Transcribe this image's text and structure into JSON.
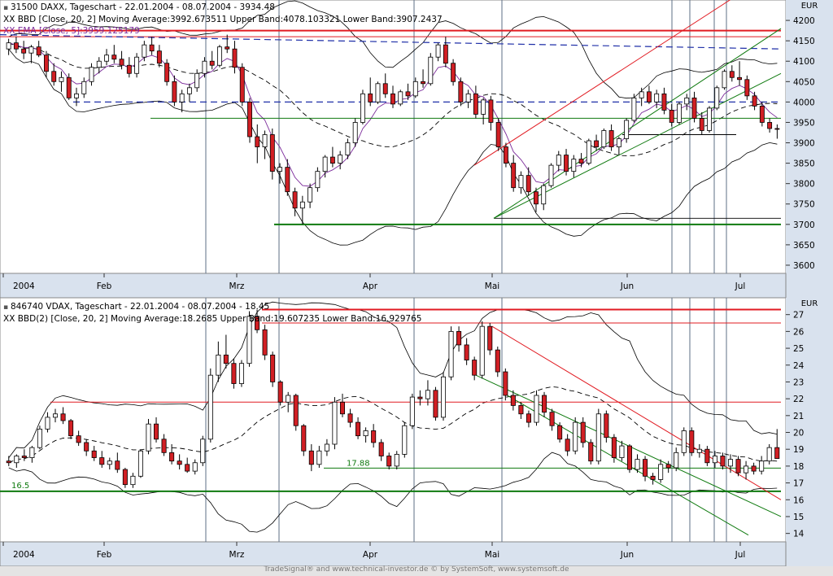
{
  "header_top": {
    "line1": "31500  DAXX, Tageschart - 22.01.2004 - 08.07.2004 - 3934.48",
    "line2": "XX BBD [Close, 20, 2] Moving Average:3992.673511 Upper Band:4078.103321 Lower Band:3907.2437",
    "line3": "XX EMA [Close, 5]:3959.125179",
    "currency": "EUR"
  },
  "header_bottom": {
    "line1": "846740  VDAX, Tageschart - 22.01.2004 - 08.07.2004 - 18.45",
    "line2": "XX BBD(2) [Close, 20, 2] Moving Average:18.2685 Upper Band:19.607235 Lower Band:16.929765",
    "currency": "EUR"
  },
  "footer_text": "TradeSignal® and www.technical-investor.de © by SystemSoft, www.systemsoft.de",
  "colors": {
    "up": "#ffffff",
    "down": "#d11f24",
    "wick": "#000000",
    "red_line": "#e11b22",
    "green_line": "#0f7a0f",
    "blue_dash": "#1f2fa8",
    "ema": "#7b2a9a",
    "vline": "#5c6f86"
  },
  "month_labels": [
    "2004",
    "Feb",
    "Mrz",
    "Apr",
    "Mai",
    "Jun",
    "Jul"
  ],
  "chart_data": [
    {
      "type": "candlestick",
      "title": "31500  DAXX, Tageschart - 22.01.2004 - 08.07.2004 - 3934.48",
      "ylim": [
        3580,
        4250
      ],
      "yticks": [
        3600,
        3650,
        3700,
        3750,
        3800,
        3850,
        3900,
        3950,
        4000,
        4050,
        4100,
        4150,
        4200
      ],
      "x_months": [
        "2004",
        "Feb",
        "Mrz",
        "Apr",
        "Mai",
        "Jun",
        "Jul"
      ],
      "ohlc": [
        [
          4130,
          4155,
          4115,
          4145
        ],
        [
          4145,
          4160,
          4120,
          4130
        ],
        [
          4130,
          4150,
          4105,
          4120
        ],
        [
          4120,
          4140,
          4095,
          4135
        ],
        [
          4135,
          4150,
          4110,
          4115
        ],
        [
          4115,
          4125,
          4060,
          4075
        ],
        [
          4075,
          4095,
          4040,
          4050
        ],
        [
          4050,
          4075,
          4025,
          4060
        ],
        [
          4060,
          4070,
          4005,
          4010
        ],
        [
          4010,
          4035,
          3990,
          4020
        ],
        [
          4020,
          4060,
          4010,
          4050
        ],
        [
          4050,
          4095,
          4040,
          4085
        ],
        [
          4085,
          4110,
          4070,
          4100
        ],
        [
          4100,
          4130,
          4090,
          4115
        ],
        [
          4115,
          4140,
          4095,
          4105
        ],
        [
          4105,
          4125,
          4080,
          4090
        ],
        [
          4090,
          4110,
          4060,
          4070
        ],
        [
          4070,
          4120,
          4060,
          4110
        ],
        [
          4110,
          4150,
          4100,
          4140
        ],
        [
          4140,
          4160,
          4115,
          4125
        ],
        [
          4125,
          4140,
          4085,
          4095
        ],
        [
          4095,
          4105,
          4040,
          4050
        ],
        [
          4050,
          4065,
          3990,
          4000
        ],
        [
          4000,
          4030,
          3975,
          4020
        ],
        [
          4020,
          4045,
          4000,
          4035
        ],
        [
          4035,
          4080,
          4025,
          4070
        ],
        [
          4070,
          4110,
          4060,
          4100
        ],
        [
          4100,
          4125,
          4080,
          4090
        ],
        [
          4090,
          4140,
          4085,
          4135
        ],
        [
          4135,
          4165,
          4120,
          4130
        ],
        [
          4130,
          4150,
          4070,
          4085
        ],
        [
          4085,
          4095,
          3990,
          4000
        ],
        [
          4000,
          4010,
          3900,
          3915
        ],
        [
          3915,
          3945,
          3850,
          3890
        ],
        [
          3890,
          3930,
          3860,
          3920
        ],
        [
          3920,
          3935,
          3810,
          3830
        ],
        [
          3830,
          3850,
          3800,
          3840
        ],
        [
          3840,
          3860,
          3770,
          3780
        ],
        [
          3780,
          3790,
          3720,
          3740
        ],
        [
          3740,
          3770,
          3700,
          3755
        ],
        [
          3755,
          3800,
          3740,
          3790
        ],
        [
          3790,
          3840,
          3780,
          3830
        ],
        [
          3830,
          3870,
          3815,
          3865
        ],
        [
          3865,
          3890,
          3840,
          3850
        ],
        [
          3850,
          3880,
          3835,
          3870
        ],
        [
          3870,
          3910,
          3860,
          3900
        ],
        [
          3900,
          3960,
          3890,
          3950
        ],
        [
          3950,
          4030,
          3945,
          4020
        ],
        [
          4020,
          4060,
          3990,
          4000
        ],
        [
          4000,
          4050,
          3995,
          4045
        ],
        [
          4045,
          4070,
          4010,
          4020
        ],
        [
          4020,
          4040,
          3985,
          3995
        ],
        [
          3995,
          4030,
          3990,
          4025
        ],
        [
          4025,
          4045,
          4005,
          4015
        ],
        [
          4015,
          4060,
          4010,
          4050
        ],
        [
          4050,
          4080,
          4035,
          4045
        ],
        [
          4045,
          4120,
          4040,
          4110
        ],
        [
          4110,
          4145,
          4100,
          4140
        ],
        [
          4140,
          4160,
          4085,
          4095
        ],
        [
          4095,
          4105,
          4040,
          4050
        ],
        [
          4050,
          4060,
          3990,
          4000
        ],
        [
          4000,
          4030,
          3985,
          4020
        ],
        [
          4020,
          4040,
          3960,
          3970
        ],
        [
          3970,
          4010,
          3945,
          4005
        ],
        [
          4005,
          4015,
          3930,
          3950
        ],
        [
          3950,
          3960,
          3880,
          3890
        ],
        [
          3890,
          3900,
          3840,
          3850
        ],
        [
          3850,
          3870,
          3780,
          3790
        ],
        [
          3790,
          3830,
          3775,
          3820
        ],
        [
          3820,
          3840,
          3770,
          3780
        ],
        [
          3780,
          3790,
          3730,
          3750
        ],
        [
          3750,
          3800,
          3735,
          3795
        ],
        [
          3795,
          3850,
          3790,
          3845
        ],
        [
          3845,
          3880,
          3830,
          3870
        ],
        [
          3870,
          3885,
          3820,
          3830
        ],
        [
          3830,
          3870,
          3815,
          3860
        ],
        [
          3860,
          3875,
          3840,
          3850
        ],
        [
          3850,
          3910,
          3845,
          3905
        ],
        [
          3905,
          3920,
          3880,
          3890
        ],
        [
          3890,
          3935,
          3885,
          3930
        ],
        [
          3930,
          3945,
          3880,
          3890
        ],
        [
          3890,
          3915,
          3870,
          3910
        ],
        [
          3910,
          3960,
          3900,
          3955
        ],
        [
          3955,
          4020,
          3950,
          4010
        ],
        [
          4010,
          4035,
          3990,
          4025
        ],
        [
          4025,
          4040,
          3995,
          4000
        ],
        [
          4000,
          4030,
          3985,
          4020
        ],
        [
          4020,
          4035,
          3970,
          3980
        ],
        [
          3980,
          3995,
          3940,
          3950
        ],
        [
          3950,
          4000,
          3945,
          3995
        ],
        [
          3995,
          4020,
          3980,
          4010
        ],
        [
          4010,
          4025,
          3950,
          3960
        ],
        [
          3960,
          3975,
          3920,
          3930
        ],
        [
          3930,
          3990,
          3925,
          3985
        ],
        [
          3985,
          4040,
          3980,
          4035
        ],
        [
          4035,
          4080,
          4030,
          4075
        ],
        [
          4075,
          4090,
          4050,
          4060
        ],
        [
          4060,
          4100,
          4040,
          4055
        ],
        [
          4055,
          4065,
          4005,
          4015
        ],
        [
          4015,
          4025,
          3980,
          3990
        ],
        [
          3990,
          4000,
          3940,
          3950
        ],
        [
          3950,
          3960,
          3925,
          3935
        ],
        [
          3935,
          3945,
          3910,
          3934
        ]
      ],
      "lines": {
        "red_horizontal": [
          4175,
          4160
        ],
        "blue_dashed_upper": [
          4165,
          4130
        ],
        "blue_dashed_mid": 4000,
        "green_horizontal": [
          3960,
          3920,
          3715,
          3700
        ],
        "green_trend_1": [
          [
            3715,
            4250
          ]
        ],
        "green_trend_2": [
          [
            3715,
            4040
          ]
        ]
      }
    },
    {
      "type": "candlestick",
      "title": "846740  VDAX, Tageschart - 22.01.2004 - 08.07.2004 - 18.45",
      "ylim": [
        13.5,
        28
      ],
      "yticks": [
        14,
        15,
        16,
        17,
        18,
        19,
        20,
        21,
        22,
        23,
        24,
        25,
        26,
        27
      ],
      "x_months": [
        "2004",
        "Feb",
        "Mrz",
        "Apr",
        "Mai",
        "Jun",
        "Jul"
      ],
      "annotations": [
        "16.5",
        "17.88"
      ],
      "ohlc": [
        [
          18.3,
          18.6,
          18.0,
          18.2
        ],
        [
          18.2,
          18.7,
          17.9,
          18.6
        ],
        [
          18.6,
          19.0,
          18.3,
          18.5
        ],
        [
          18.5,
          19.2,
          18.2,
          19.1
        ],
        [
          19.1,
          20.4,
          19.0,
          20.2
        ],
        [
          20.2,
          21.2,
          20.0,
          20.9
        ],
        [
          20.9,
          21.4,
          20.6,
          21.1
        ],
        [
          21.1,
          21.5,
          20.5,
          20.7
        ],
        [
          20.7,
          20.8,
          19.6,
          19.8
        ],
        [
          19.8,
          20.1,
          19.2,
          19.4
        ],
        [
          19.4,
          19.6,
          18.6,
          18.9
        ],
        [
          18.9,
          19.2,
          18.3,
          18.5
        ],
        [
          18.5,
          18.9,
          17.9,
          18.1
        ],
        [
          18.1,
          18.5,
          17.8,
          18.3
        ],
        [
          18.3,
          18.8,
          17.6,
          17.8
        ],
        [
          17.8,
          17.9,
          16.7,
          16.9
        ],
        [
          16.9,
          17.6,
          16.7,
          17.4
        ],
        [
          17.4,
          19.0,
          17.3,
          18.9
        ],
        [
          18.9,
          20.8,
          18.7,
          20.5
        ],
        [
          20.5,
          20.9,
          19.4,
          19.6
        ],
        [
          19.6,
          19.9,
          18.6,
          18.8
        ],
        [
          18.8,
          19.3,
          18.1,
          18.3
        ],
        [
          18.3,
          18.7,
          17.8,
          18.1
        ],
        [
          18.1,
          18.5,
          17.6,
          17.7
        ],
        [
          17.7,
          18.4,
          17.5,
          18.2
        ],
        [
          18.2,
          19.8,
          18.0,
          19.6
        ],
        [
          19.6,
          23.8,
          19.4,
          23.4
        ],
        [
          23.4,
          25.4,
          23.0,
          24.6
        ],
        [
          24.6,
          25.8,
          23.8,
          24.1
        ],
        [
          24.1,
          24.4,
          22.6,
          22.9
        ],
        [
          22.9,
          24.3,
          22.7,
          24.1
        ],
        [
          24.1,
          27.2,
          23.9,
          26.9
        ],
        [
          26.9,
          27.3,
          25.9,
          26.1
        ],
        [
          26.1,
          26.4,
          24.3,
          24.6
        ],
        [
          24.6,
          24.8,
          22.7,
          23.0
        ],
        [
          23.0,
          23.1,
          21.6,
          21.8
        ],
        [
          21.8,
          22.4,
          21.2,
          22.2
        ],
        [
          22.2,
          22.3,
          20.1,
          20.4
        ],
        [
          20.4,
          20.5,
          18.6,
          18.9
        ],
        [
          18.9,
          19.3,
          17.7,
          18.1
        ],
        [
          18.1,
          19.2,
          17.9,
          18.9
        ],
        [
          18.9,
          19.6,
          18.6,
          19.3
        ],
        [
          19.3,
          22.1,
          19.0,
          21.8
        ],
        [
          21.8,
          22.3,
          20.9,
          21.1
        ],
        [
          21.1,
          21.4,
          20.3,
          20.6
        ],
        [
          20.6,
          20.9,
          19.6,
          19.8
        ],
        [
          19.8,
          20.3,
          19.4,
          20.1
        ],
        [
          20.1,
          20.5,
          19.1,
          19.4
        ],
        [
          19.4,
          19.6,
          18.3,
          18.6
        ],
        [
          18.6,
          18.8,
          17.8,
          18.0
        ],
        [
          18.0,
          18.9,
          17.8,
          18.7
        ],
        [
          18.7,
          20.6,
          18.5,
          20.4
        ],
        [
          20.4,
          22.3,
          20.2,
          22.1
        ],
        [
          22.1,
          22.5,
          21.6,
          22.0
        ],
        [
          22.0,
          23.1,
          21.6,
          22.5
        ],
        [
          22.5,
          22.7,
          20.7,
          20.9
        ],
        [
          20.9,
          23.6,
          20.7,
          23.3
        ],
        [
          23.3,
          26.3,
          23.1,
          26.0
        ],
        [
          26.0,
          26.3,
          24.8,
          25.2
        ],
        [
          25.2,
          25.6,
          24.0,
          24.3
        ],
        [
          24.3,
          24.5,
          23.1,
          23.4
        ],
        [
          23.4,
          26.6,
          23.2,
          26.3
        ],
        [
          26.3,
          26.5,
          24.6,
          24.9
        ],
        [
          24.9,
          25.1,
          23.3,
          23.6
        ],
        [
          23.6,
          23.8,
          21.9,
          22.2
        ],
        [
          22.2,
          22.5,
          21.3,
          21.6
        ],
        [
          21.6,
          21.8,
          20.8,
          21.1
        ],
        [
          21.1,
          21.3,
          20.3,
          20.6
        ],
        [
          20.6,
          22.5,
          20.4,
          22.2
        ],
        [
          22.2,
          22.4,
          20.9,
          21.2
        ],
        [
          21.2,
          21.4,
          20.1,
          20.4
        ],
        [
          20.4,
          20.6,
          19.4,
          19.6
        ],
        [
          19.6,
          19.9,
          18.6,
          18.9
        ],
        [
          18.9,
          20.9,
          18.7,
          20.6
        ],
        [
          20.6,
          20.9,
          19.1,
          19.4
        ],
        [
          19.4,
          19.6,
          18.1,
          18.3
        ],
        [
          18.3,
          21.4,
          18.1,
          21.1
        ],
        [
          21.1,
          21.3,
          19.4,
          19.7
        ],
        [
          19.7,
          19.9,
          18.2,
          18.5
        ],
        [
          18.5,
          19.5,
          18.3,
          19.2
        ],
        [
          19.2,
          19.3,
          17.6,
          17.8
        ],
        [
          17.8,
          18.7,
          17.6,
          18.4
        ],
        [
          18.4,
          18.6,
          17.1,
          17.4
        ],
        [
          17.4,
          17.6,
          16.9,
          17.2
        ],
        [
          17.2,
          18.4,
          17.0,
          18.1
        ],
        [
          18.1,
          18.3,
          17.6,
          17.9
        ],
        [
          17.9,
          19.1,
          17.7,
          18.8
        ],
        [
          18.8,
          20.3,
          18.6,
          20.1
        ],
        [
          20.1,
          20.3,
          18.6,
          18.8
        ],
        [
          18.8,
          19.3,
          18.5,
          19.0
        ],
        [
          19.0,
          19.2,
          18.0,
          18.2
        ],
        [
          18.2,
          18.9,
          17.9,
          18.6
        ],
        [
          18.6,
          18.8,
          17.8,
          18.0
        ],
        [
          18.0,
          18.7,
          17.6,
          18.4
        ],
        [
          18.4,
          18.6,
          17.4,
          17.6
        ],
        [
          17.6,
          18.3,
          17.2,
          18.0
        ],
        [
          18.0,
          18.2,
          17.5,
          17.7
        ],
        [
          17.7,
          18.6,
          17.5,
          18.3
        ],
        [
          18.3,
          19.3,
          18.1,
          19.1
        ],
        [
          19.1,
          20.2,
          18.9,
          18.45
        ]
      ],
      "lines": {
        "red_horizontal": [
          27.3,
          26.5,
          21.8
        ],
        "green_horizontal": [
          17.88,
          16.5
        ]
      }
    }
  ]
}
